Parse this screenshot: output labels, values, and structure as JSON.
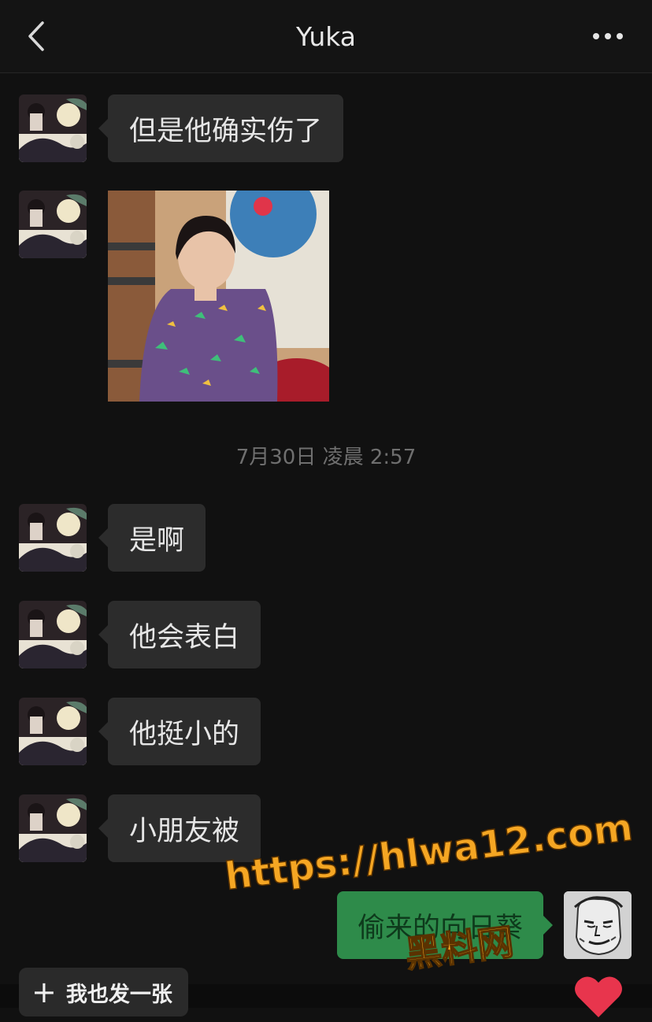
{
  "header": {
    "title": "Yuka",
    "back_icon": "chevron-left-icon",
    "more_icon": "ellipsis-icon"
  },
  "messages_before": [
    {
      "type": "text",
      "text": "但是他确实伤了"
    },
    {
      "type": "image"
    }
  ],
  "timestamp": "7月30日 凌晨 2:57",
  "messages_after": [
    {
      "text": "是啊"
    },
    {
      "text": "他会表白"
    },
    {
      "text": "他挺小的"
    },
    {
      "text": "小朋友被"
    }
  ],
  "own_message": {
    "text": "偷来的向日葵"
  },
  "watermark": {
    "url": "https://hlwa12.com",
    "label": "黑料网"
  },
  "bottom": {
    "share_label": "我也发一张",
    "share_icon": "plus-icon",
    "heart_icon": "heart-icon",
    "heart_color": "#e8354d"
  },
  "colors": {
    "background": "#111111",
    "bubble": "#2c2c2c",
    "own_bubble": "#2e8b4a",
    "watermark": "#f5a623"
  }
}
